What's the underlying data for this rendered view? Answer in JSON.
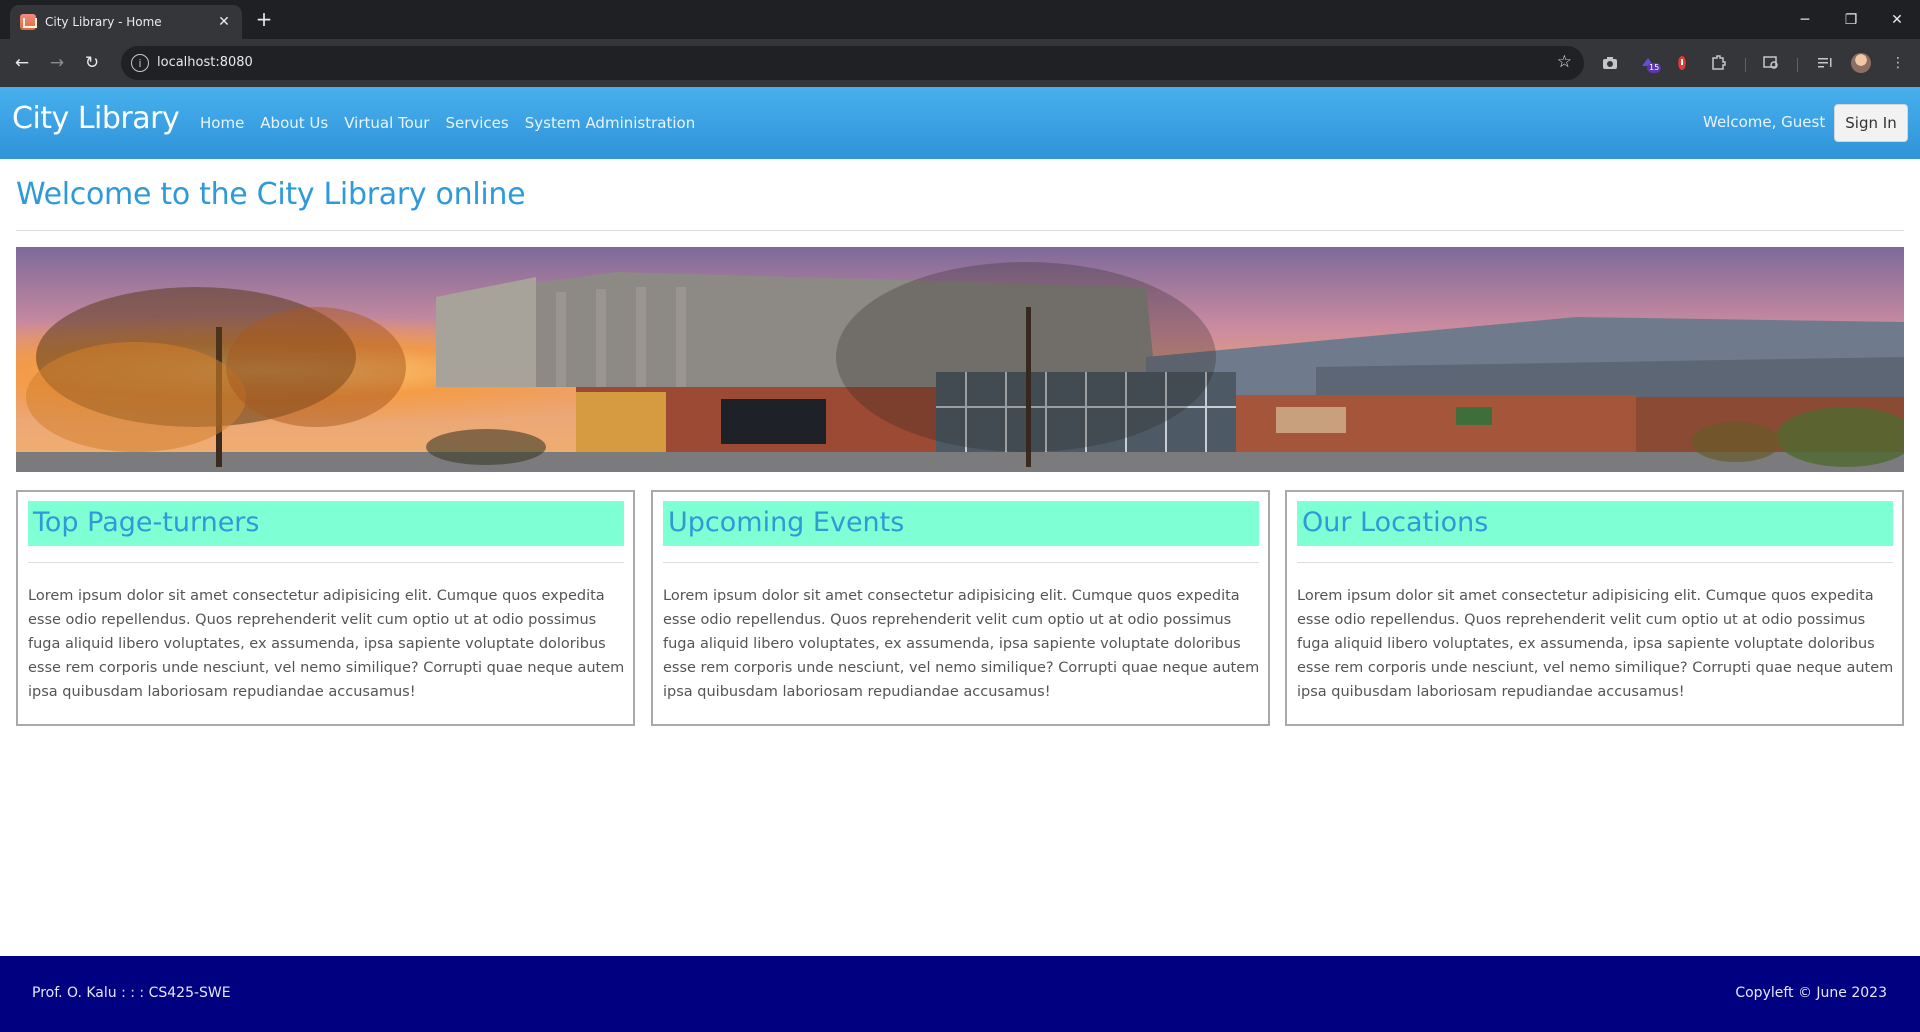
{
  "browser": {
    "tab_title": "City Library - Home",
    "url": "localhost:8080",
    "extension_badge": "15"
  },
  "site": {
    "brand": "City Library",
    "nav": [
      "Home",
      "About Us",
      "Virtual Tour",
      "Services",
      "System Administration"
    ],
    "welcome": "Welcome, Guest",
    "signin": "Sign In"
  },
  "main": {
    "title": "Welcome to the City Library online",
    "cards": [
      {
        "heading": "Top Page-turners",
        "body": "Lorem ipsum dolor sit amet consectetur adipisicing elit. Cumque quos expedita esse odio repellendus. Quos reprehenderit velit cum optio ut at odio possimus fuga aliquid libero voluptates, ex assumenda, ipsa sapiente voluptate doloribus esse rem corporis unde nesciunt, vel nemo similique? Corrupti quae neque autem ipsa quibusdam laboriosam repudiandae accusamus!"
      },
      {
        "heading": "Upcoming Events",
        "body": "Lorem ipsum dolor sit amet consectetur adipisicing elit. Cumque quos expedita esse odio repellendus. Quos reprehenderit velit cum optio ut at odio possimus fuga aliquid libero voluptates, ex assumenda, ipsa sapiente voluptate doloribus esse rem corporis unde nesciunt, vel nemo similique? Corrupti quae neque autem ipsa quibusdam laboriosam repudiandae accusamus!"
      },
      {
        "heading": "Our Locations",
        "body": "Lorem ipsum dolor sit amet consectetur adipisicing elit. Cumque quos expedita esse odio repellendus. Quos reprehenderit velit cum optio ut at odio possimus fuga aliquid libero voluptates, ex assumenda, ipsa sapiente voluptate doloribus esse rem corporis unde nesciunt, vel nemo similique? Corrupti quae neque autem ipsa quibusdam laboriosam repudiandae accusamus!"
      }
    ]
  },
  "footer": {
    "left": "Prof. O. Kalu : : : CS425-SWE",
    "right": "Copyleft © June 2023"
  },
  "colors": {
    "navbar": "#3aa2e3",
    "title": "#2e9ad8",
    "card_head_bg": "#7fffd4",
    "footer_bg": "#000080"
  },
  "icons": [
    "back-icon",
    "forward-icon",
    "reload-icon",
    "site-info-icon",
    "bookmark-star-icon",
    "camera-icon",
    "extensions-icon",
    "profile-avatar"
  ]
}
